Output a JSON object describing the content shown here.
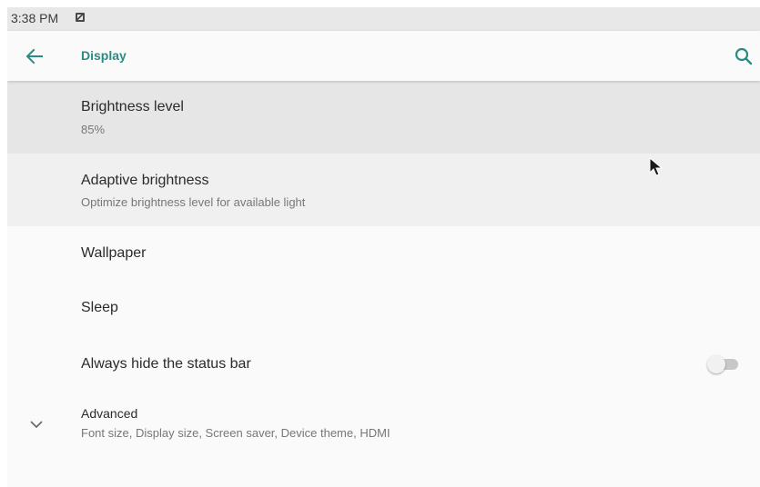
{
  "status_bar": {
    "time": "3:38 PM",
    "notification_icon": "image-notification-icon"
  },
  "app_bar": {
    "title": "Display",
    "back_icon": "arrow-back-icon",
    "search_icon": "search-icon",
    "accent_color": "#2a8b82"
  },
  "settings": {
    "brightness": {
      "title": "Brightness level",
      "summary": "85%"
    },
    "adaptive": {
      "title": "Adaptive brightness",
      "summary": "Optimize brightness level for available light"
    },
    "wallpaper": {
      "title": "Wallpaper"
    },
    "sleep": {
      "title": "Sleep"
    },
    "hide_status_bar": {
      "title": "Always hide the status bar",
      "enabled": false
    },
    "advanced": {
      "title": "Advanced",
      "summary": "Font size, Display size, Screen saver, Device theme, HDMI",
      "expand_icon": "chevron-down-icon"
    }
  }
}
